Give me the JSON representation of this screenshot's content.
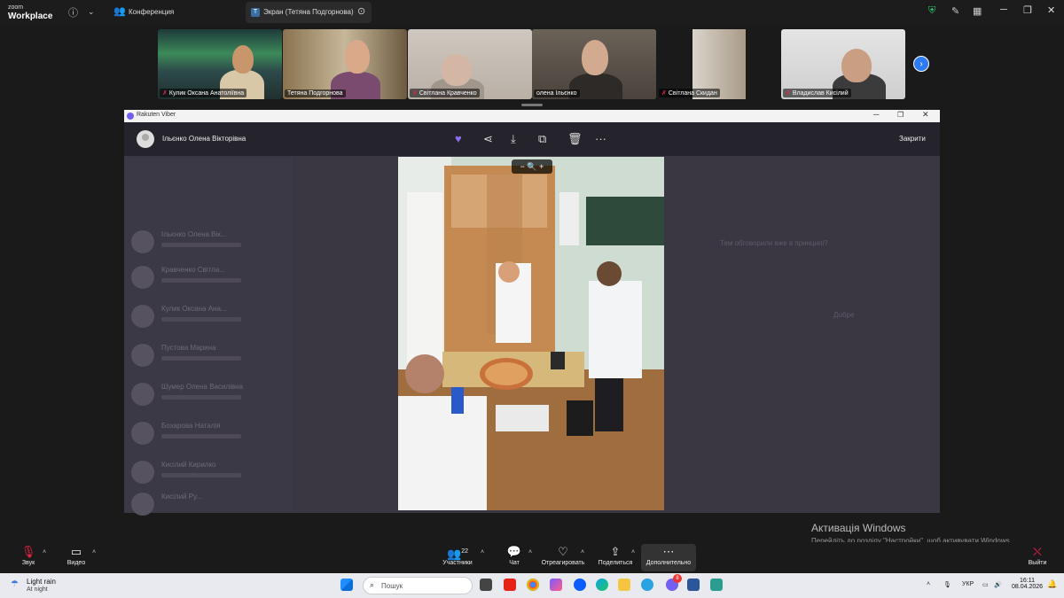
{
  "zoom": {
    "logo_line1": "zoom",
    "logo_line2": "Workplace",
    "meeting_tab": "Конференция",
    "share_tab": "Экран (Тетяна Подгорнова)",
    "share_tab_badge": "T"
  },
  "participants": [
    {
      "name": "Кулик Оксана Анатоліївна",
      "muted": true
    },
    {
      "name": "Тетяна Подгорнова",
      "muted": false
    },
    {
      "name": "Світлана Кравченко",
      "muted": true
    },
    {
      "name": "олена Ільєнко",
      "muted": false,
      "active": true
    },
    {
      "name": "Світлана Скидан",
      "muted": true
    },
    {
      "name": "Владислав Кисілий",
      "muted": true
    }
  ],
  "viber": {
    "window_title": "Rakuten Viber",
    "contact_name": "Ільєнко Олена Вікторівна",
    "close_label": "Закрити",
    "zoom_controls": "−  🔍  +"
  },
  "background_list": [
    {
      "name": "Ільєнко Олена Вік..."
    },
    {
      "name": "Кравченко Світла..."
    },
    {
      "name": "Кулик Оксана Ана..."
    },
    {
      "name": "Пустова Марина"
    },
    {
      "name": "Шумер Олена Василівна"
    },
    {
      "name": "Бохарова Наталія"
    },
    {
      "name": "Кисілий Кирилко"
    },
    {
      "name": "Кисілий Ру..."
    }
  ],
  "background_right": {
    "q1": "Тем обговорили вже в принципі?",
    "q2": "Добре"
  },
  "activation": {
    "title": "Активація Windows",
    "subtitle": "Перейдіть до розділу \"Настройки\", щоб активувати Windows."
  },
  "toolbar": {
    "audio": "Звук",
    "video": "Видео",
    "participants": "Участники",
    "participants_count": "22",
    "chat": "Чат",
    "react": "Отреагировать",
    "share": "Поделиться",
    "more": "Дополнительно",
    "leave": "Выйти"
  },
  "taskbar": {
    "weather_line1": "Light rain",
    "weather_line2": "At night",
    "search_placeholder": "Пошук",
    "language": "УКР",
    "time": "16:11",
    "date": "08.04.2026",
    "viber_badge": "8"
  }
}
